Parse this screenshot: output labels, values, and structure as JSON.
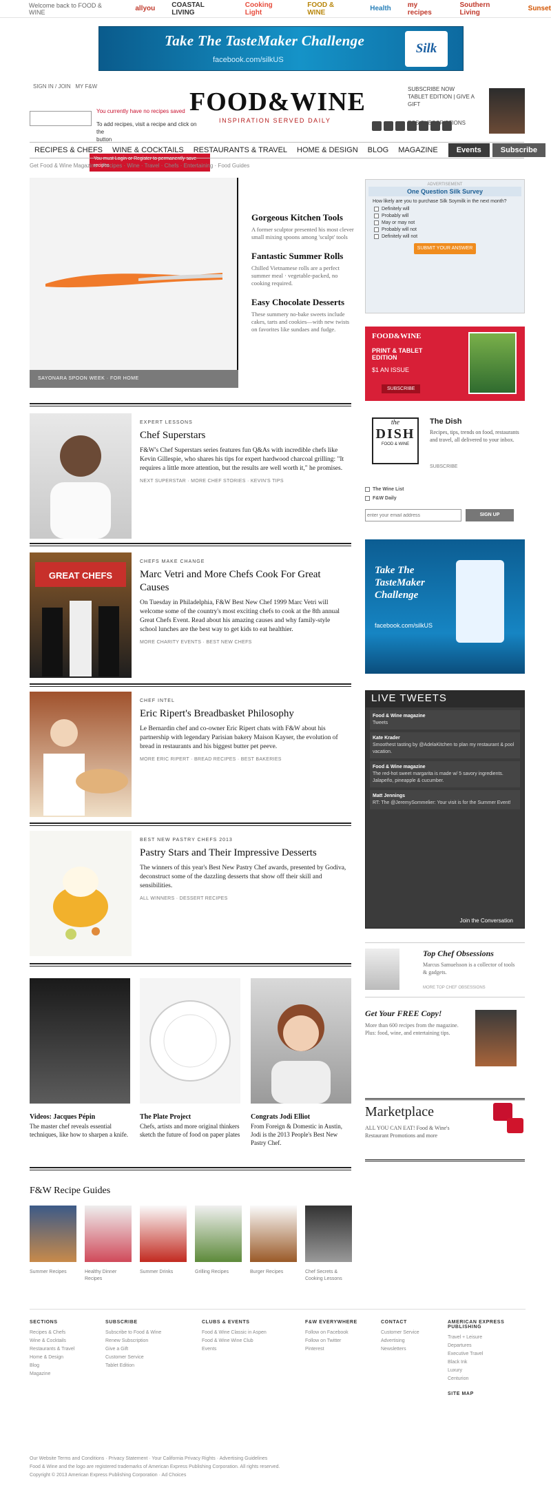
{
  "topstrip": {
    "welcome": "Welcome back to FOOD & WINE",
    "brands": [
      {
        "label": "allyou",
        "color": "#c0392b"
      },
      {
        "label": "COASTAL LIVING",
        "color": "#333333"
      },
      {
        "label": "Cooking Light",
        "color": "#e74c3c"
      },
      {
        "label": "FOOD & WINE",
        "color": "#b8860b"
      },
      {
        "label": "Health",
        "color": "#2980b9"
      },
      {
        "label": "my recipes",
        "color": "#c0392b"
      },
      {
        "label": "Southern Living",
        "color": "#c0392b"
      },
      {
        "label": "Sunset",
        "color": "#d35400"
      }
    ]
  },
  "banner": {
    "headline": "Take The TasteMaker Challenge",
    "sub": "facebook.com/silkUS",
    "product": "Silk"
  },
  "header": {
    "logo": "FOOD&WINE",
    "tagline": "INSPIRATION SERVED DAILY",
    "signin_1": "SIGN IN / JOIN",
    "signin_2": "MY F&W",
    "recipebox_line1": "You currently have no recipes saved",
    "recipebox_line2": "To add recipes, visit a recipe and click on the",
    "recipebox_line3": "button",
    "redbox_text": "You must Login or Register to permanently save recipes",
    "mag_line1": "TABLET EDITION | GIVE A GIFT",
    "mag_line2": "SUBSCRIBE NOW",
    "rss": "RSS SUBSCRIPTIONS"
  },
  "nav": {
    "items": [
      "RECIPES & CHEFS",
      "WINE & COCKTAILS",
      "RESTAURANTS & TRAVEL",
      "HOME & DESIGN",
      "BLOG",
      "MAGAZINE"
    ],
    "events": "Events",
    "subscribe": "Subscribe",
    "sub_links": "Get Food & Wine Magazine · Recipes · Wine · Travel · Chefs · Entertaining · Food Guides"
  },
  "hero": {
    "caption": "SAYONARA SPOON WEEK · FOR HOME",
    "list": [
      {
        "title": "Gorgeous Kitchen Tools",
        "desc": "A former sculptor presented his most clever small mixing spoons among 'sculpt' tools"
      },
      {
        "title": "Fantastic Summer Rolls",
        "desc": "Chilled Vietnamese rolls are a perfect summer meal · vegetable-packed, no cooking required."
      },
      {
        "title": "Easy Chocolate Desserts",
        "desc": "These summery no-bake sweets include cakes, tarts and cookies—with new twists on favorites like sundaes and fudge."
      }
    ]
  },
  "stories": [
    {
      "kicker": "EXPERT LESSONS",
      "title": "Chef Superstars",
      "text": "F&W's Chef Superstars series features fun Q&As with incredible chefs like Kevin Gillespie, who shares his tips for expert hardwood charcoal grilling: \"It requires a little more attention, but the results are well worth it,\" he promises.",
      "links": "NEXT SUPERSTAR · MORE CHEF STORIES · KEVIN'S TIPS"
    },
    {
      "kicker": "CHEFS MAKE CHANGE",
      "title": "Marc Vetri and More Chefs Cook For Great Causes",
      "text": "On Tuesday in Philadelphia, F&W Best New Chef 1999 Marc Vetri will welcome some of the country's most exciting chefs to cook at the 8th annual Great Chefs Event. Read about his amazing causes and why family-style school lunches are the best way to get kids to eat healthier.",
      "links": "MORE CHARITY EVENTS · BEST NEW CHEFS"
    },
    {
      "kicker": "CHEF INTEL",
      "title": "Eric Ripert's Breadbasket Philosophy",
      "text": "Le Bernardin chef and co-owner Eric Ripert chats with F&W about his partnership with legendary Parisian bakery Maison Kayser, the evolution of bread in restaurants and his biggest butter pet peeve.",
      "links": "MORE ERIC RIPERT · BREAD RECIPES · BEST BAKERIES"
    },
    {
      "kicker": "BEST NEW PASTRY CHEFS 2013",
      "title": "Pastry Stars and Their Impressive Desserts",
      "text": "The winners of this year's Best New Pastry Chef awards, presented by Godiva, deconstruct some of the dazzling desserts that show off their skill and sensibilities.",
      "links": "ALL WINNERS · DESSERT RECIPES"
    }
  ],
  "cards": [
    {
      "title": "Videos: Jacques Pépin",
      "desc": "The master chef reveals essential techniques, like how to sharpen a knife."
    },
    {
      "title": "The Plate Project",
      "desc": "Chefs, artists and more original thinkers sketch the future of food on paper plates"
    },
    {
      "title": "Congrats Jodi Elliot",
      "desc": "From Foreign & Domestic in Austin, Jodi is the 2013 People's Best New Pastry Chef."
    }
  ],
  "guides": {
    "title": "F&W Recipe Guides",
    "items": [
      "Summer Recipes",
      "Healthy Dinner Recipes",
      "Summer Drinks",
      "Grilling Recipes",
      "Burger Recipes",
      "Chef Secrets & Cooking Lessons"
    ]
  },
  "footer": {
    "cols": [
      {
        "head": "SECTIONS",
        "links": [
          "Recipes & Chefs",
          "Wine & Cocktails",
          "Restaurants & Travel",
          "Home & Design",
          "Blog",
          "Magazine"
        ]
      },
      {
        "head": "SUBSCRIBE",
        "links": [
          "Subscribe to Food & Wine",
          "Renew Subscription",
          "Give a Gift",
          "Customer Service",
          "Tablet Edition"
        ]
      },
      {
        "head": "CLUBS & EVENTS",
        "links": [
          "Food & Wine Classic in Aspen",
          "Food & Wine Wine Club",
          "Events"
        ]
      },
      {
        "head": "F&W EVERYWHERE",
        "links": [
          "Follow on Facebook",
          "Follow on Twitter",
          "Pinterest"
        ]
      },
      {
        "head": "CONTACT",
        "links": [
          "Customer Service",
          "Advertising",
          "Newsletters"
        ]
      },
      {
        "head": "AMERICAN EXPRESS PUBLISHING",
        "links": [
          "Travel + Leisure",
          "Departures",
          "Executive Travel",
          "Black Ink",
          "Luxury",
          "Centurion"
        ]
      }
    ],
    "sitemap": "SITE MAP",
    "bottom1": "Our Website Terms and Conditions · Privacy Statement · Your California Privacy Rights · Advertising Guidelines",
    "bottom2": "Food & Wine and the logo are registered trademarks of American Express Publishing Corporation. All rights reserved.",
    "bottom3": "Copyright © 2013 American Express Publishing Corporation · Ad Choices"
  },
  "sidebar": {
    "poll_label": "ADVERTISEMENT",
    "poll_title": "One Question Silk Survey",
    "poll_question": "How likely are you to purchase Silk Soymilk in the next month?",
    "poll_options": [
      "Definitely will",
      "Probably will",
      "May or may not",
      "Probably will not",
      "Definitely will not"
    ],
    "poll_button": "SUBMIT YOUR ANSWER",
    "print_logo": "FOOD&WINE",
    "print_line1": "PRINT & TABLET EDITION",
    "print_line2": "$1 AN ISSUE",
    "print_button": "SUBSCRIBE",
    "dish_logo_top": "the",
    "dish_logo_main": "DISH",
    "dish_logo_sub": "FOOD & WINE",
    "dish_title": "The Dish",
    "dish_text": "Recipes, tips, trends on food, restaurants and travel, all delivered to your inbox.",
    "dish_more": "SUBSCRIBE",
    "newsletter_1": "The Wine List",
    "newsletter_2": "F&W Daily",
    "newsletter_placeholder": "enter your email address",
    "signup_button": "SIGN UP",
    "silkad_headline": "Take The TasteMaker Challenge",
    "silkad_sub": "facebook.com/silkUS",
    "tweets_title": "LIVE TWEETS",
    "tweets": [
      {
        "user": "Food & Wine magazine",
        "text": "Tweets"
      },
      {
        "user": "Kate Krader",
        "text": "Smoothest tasting by @AdelaKitchen to plan my restaurant & pool vacation."
      },
      {
        "user": "Food & Wine magazine",
        "text": "The red-hot sweet margarita is made w/ 5 savory ingredients. Jalapeño, pineapple & cucumber."
      },
      {
        "user": "Matt Jennings",
        "text": "RT: The @JeremySommelier: Your visit is for the Summer Event!"
      }
    ],
    "tweets_join": "Join the Conversation",
    "obsess_title": "Top Chef Obsessions",
    "obsess_text": "Marcus Samuelsson is a collector of tools & gadgets.",
    "obsess_more": "MORE TOP CHEF OBSESSIONS",
    "free_title": "Get Your FREE Copy!",
    "free_text": "More than 600 recipes from the magazine. Plus: food, wine, and entertaining tips.",
    "market_title": "Marketplace",
    "market_text": "ALL YOU CAN EAT! Food & Wine's Restaurant Promotions and more"
  }
}
